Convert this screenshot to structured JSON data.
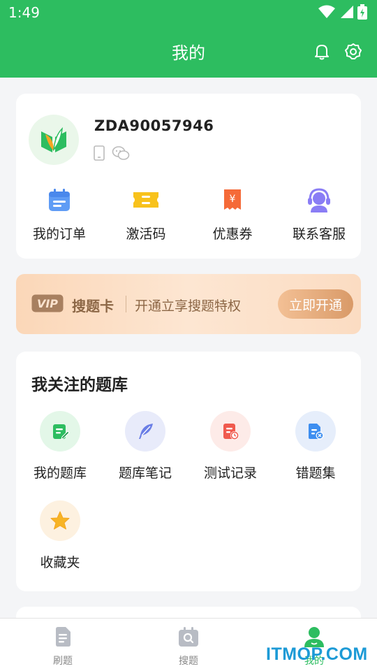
{
  "status_bar": {
    "time": "1:49"
  },
  "header": {
    "title": "我的"
  },
  "profile": {
    "username": "ZDA90057946"
  },
  "quick_actions": [
    {
      "label": "我的订单",
      "icon": "calendar-icon"
    },
    {
      "label": "激活码",
      "icon": "ticket-icon"
    },
    {
      "label": "优惠券",
      "icon": "coupon-yen-icon"
    },
    {
      "label": "联系客服",
      "icon": "headset-icon"
    }
  ],
  "vip": {
    "badge": "VIP",
    "title": "搜题卡",
    "subtitle": "开通立享搜题特权",
    "button": "立即开通"
  },
  "question_bank": {
    "title": "我关注的题库",
    "items": [
      {
        "label": "我的题库",
        "icon": "edit-note-icon",
        "color": "#2dbd60"
      },
      {
        "label": "题库笔记",
        "icon": "feather-icon",
        "color": "#6b7fe6"
      },
      {
        "label": "测试记录",
        "icon": "test-record-icon",
        "color": "#f05a4e"
      },
      {
        "label": "错题集",
        "icon": "wrong-doc-icon",
        "color": "#3d8ef0"
      },
      {
        "label": "收藏夹",
        "icon": "star-icon",
        "color": "#f5a623"
      }
    ]
  },
  "tabbar": {
    "tabs": [
      {
        "label": "刷题",
        "icon": "document-icon",
        "active": false
      },
      {
        "label": "搜题",
        "icon": "search-icon",
        "active": false
      },
      {
        "label": "我的",
        "icon": "user-icon",
        "active": true
      }
    ]
  },
  "watermark": "ITMOP.COM",
  "colors": {
    "brand": "#2dbd60",
    "vip_text": "#8c6746"
  }
}
